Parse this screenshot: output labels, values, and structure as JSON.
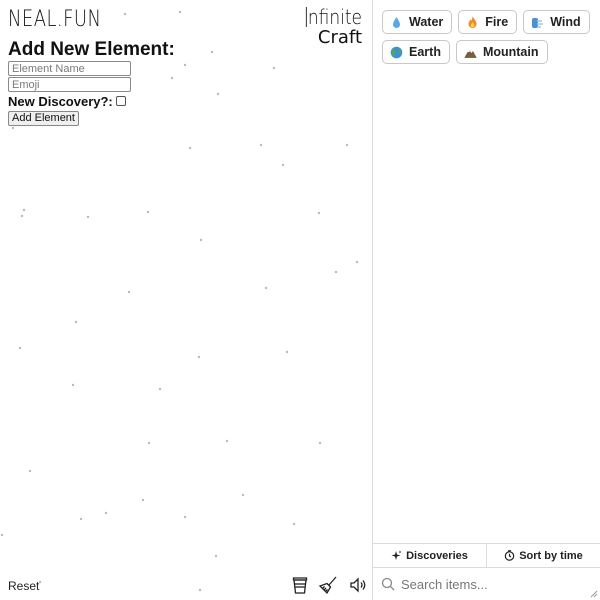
{
  "logo": "NEAL.FUN",
  "title": {
    "line1": "nfinite",
    "line2": "Craft"
  },
  "form": {
    "heading": "Add New Element:",
    "name_placeholder": "Element Name",
    "emoji_placeholder": "Emoji",
    "discovery_label": "New Discovery?:",
    "submit_label": "Add Element"
  },
  "footer": {
    "reset_label": "Reset"
  },
  "sidebar": {
    "items": [
      {
        "label": "Water",
        "icon": "water-drop-icon"
      },
      {
        "label": "Fire",
        "icon": "fire-icon"
      },
      {
        "label": "Wind",
        "icon": "wind-icon"
      },
      {
        "label": "Earth",
        "icon": "globe-icon"
      },
      {
        "label": "Mountain",
        "icon": "mountain-icon"
      }
    ],
    "tabs": {
      "discoveries": "Discoveries",
      "sort": "Sort by time"
    },
    "search_placeholder": "Search items..."
  },
  "colors": {
    "divider": "#dcdcdc",
    "dots": "#b8b8c8"
  }
}
